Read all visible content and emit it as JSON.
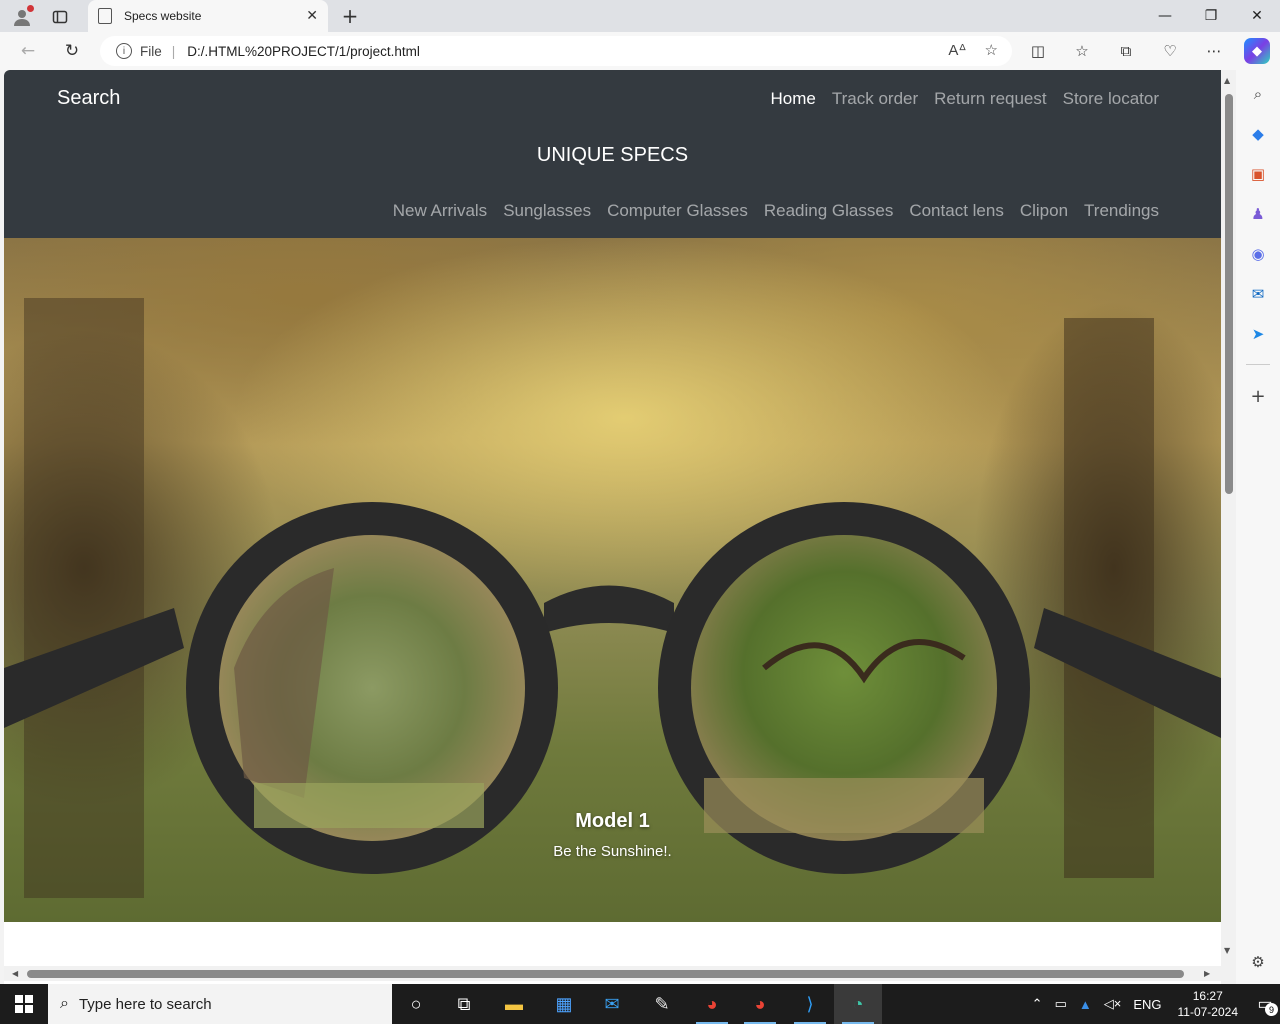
{
  "browser": {
    "tab_title": "Specs website",
    "address_prefix": "File",
    "url": "D:/.HTML%20PROJECT/1/project.html"
  },
  "site": {
    "brand": "Search",
    "top_nav": [
      "Home",
      "Track order",
      "Return request",
      "Store locator"
    ],
    "name": "UNIQUE SPECS",
    "categories": [
      "New Arrivals",
      "Sunglasses",
      "Computer Glasses",
      "Reading Glasses",
      "Contact lens",
      "Clipon",
      "Trendings"
    ]
  },
  "hero": {
    "caption_title": "Model 1",
    "caption_text": "Be the Sunshine!."
  },
  "taskbar": {
    "search_placeholder": "Type here to search",
    "language": "ENG",
    "time": "16:27",
    "date": "11-07-2024",
    "notification_count": "9"
  },
  "colors": {
    "navbar_bg": "#343a40",
    "nav_active": "#ffffff",
    "nav_inactive": "rgba(255,255,255,0.55)"
  }
}
